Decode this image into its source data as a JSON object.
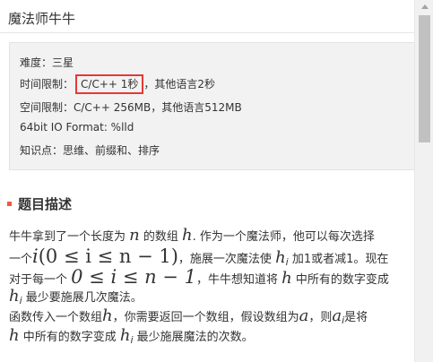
{
  "page": {
    "title": "魔法师牛牛"
  },
  "info": {
    "difficulty": "难度：三星",
    "time_limit_label": "时间限制：",
    "time_limit_cpp": "C/C++ 1秒",
    "time_limit_other": "，其他语言2秒",
    "space_limit": "空间限制：C/C++ 256MB，其他语言512MB",
    "io_format": "64bit IO Format: %lld",
    "knowledge": "知识点：思维、前缀和、排序"
  },
  "section": {
    "title": "题目描述"
  },
  "description": {
    "l1_a": "牛牛拿到了一个长度为 ",
    "l1_n": "n",
    "l1_b": " 的数组 ",
    "l1_h": "h",
    "l1_c": ". 作为一个魔法师，他可以每次选择",
    "l2_a": "一个",
    "l2_i": "i",
    "l2_expr": "(0 ≤ i ≤ n − 1)",
    "l2_b": "，施展一次魔法使 ",
    "l2_h": "h",
    "l2_sub": "i",
    "l2_c": " 加1或者减1。现在",
    "l3_a": "对于每一个 ",
    "l3_expr": "0 ≤ i ≤ n − 1",
    "l3_b": "，牛牛想知道将 ",
    "l3_h": "h",
    "l3_c": " 中所有的数字变成",
    "l4_h": "h",
    "l4_sub": "i",
    "l4_a": " 最少要施展几次魔法。",
    "l5_a": "函数传入一个数组",
    "l5_h": "h",
    "l5_b": "，你需要返回一个数组，假设数组为",
    "l5_a_var": "a",
    "l5_c": "，则",
    "l5_ai": "a",
    "l5_ai_sub": "i",
    "l5_d": "是将",
    "l6_h": "h",
    "l6_a": " 中所有的数字变成 ",
    "l6_hi": "h",
    "l6_hi_sub": "i",
    "l6_b": " 最少施展魔法的次数。"
  }
}
